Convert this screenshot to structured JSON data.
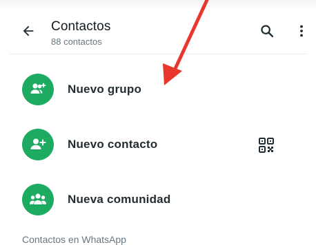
{
  "header": {
    "title": "Contactos",
    "subtitle": "88 contactos",
    "back_icon": "back-arrow-icon",
    "search_icon": "search-icon",
    "more_icon": "more-vertical-icon"
  },
  "options": [
    {
      "label": "Nuevo grupo",
      "icon": "new-group-icon"
    },
    {
      "label": "Nuevo contacto",
      "icon": "add-contact-icon",
      "trailing_icon": "qr-code-icon"
    },
    {
      "label": "Nueva comunidad",
      "icon": "community-icon"
    }
  ],
  "section_header": "Contactos en WhatsApp",
  "colors": {
    "accent": "#1daa61",
    "annotation_arrow": "#e8372c",
    "subtitle": "#667781"
  }
}
